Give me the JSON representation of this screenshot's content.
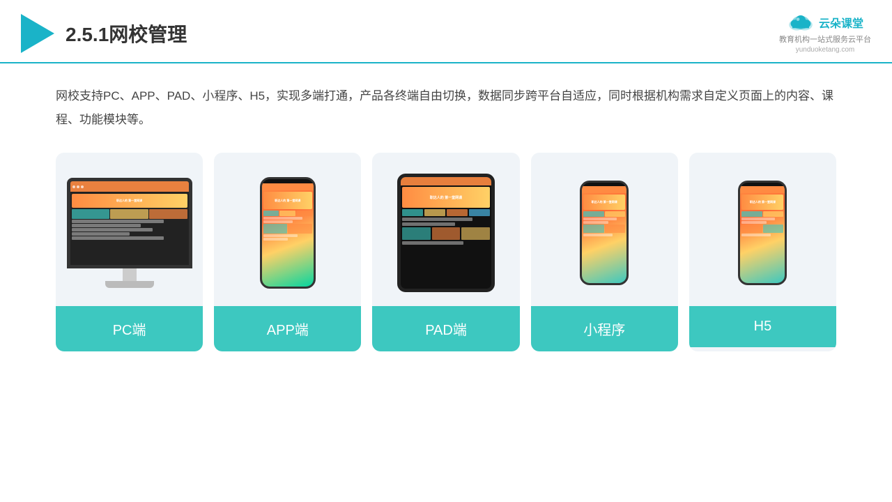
{
  "header": {
    "title": "2.5.1网校管理",
    "brand": {
      "name": "云朵课堂",
      "url": "yunduoketang.com",
      "subtitle": "教育机构一站式服务云平台"
    }
  },
  "description": "网校支持PC、APP、PAD、小程序、H5，实现多端打通，产品各终端自由切换，数据同步跨平台自适应，同时根据机构需求自定义页面上的内容、课程、功能模块等。",
  "cards": [
    {
      "id": "pc",
      "label": "PC端"
    },
    {
      "id": "app",
      "label": "APP端"
    },
    {
      "id": "pad",
      "label": "PAD端"
    },
    {
      "id": "miniapp",
      "label": "小程序"
    },
    {
      "id": "h5",
      "label": "H5"
    }
  ],
  "colors": {
    "accent": "#1ab3c8",
    "teal": "#3dc8c0"
  }
}
